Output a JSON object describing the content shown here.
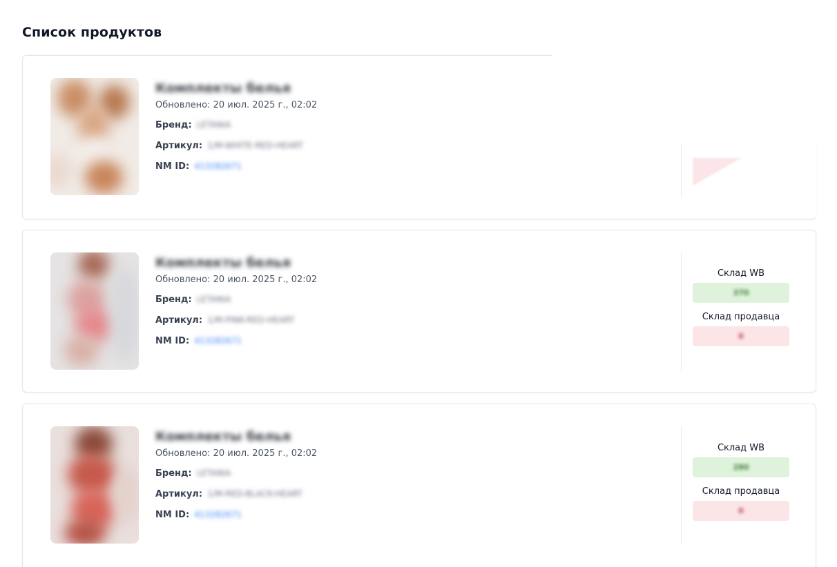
{
  "page": {
    "title": "Список продуктов"
  },
  "labels": {
    "brand": "Бренд:",
    "article": "Артикул:",
    "nm_id": "NM ID:",
    "stock_wb": "Склад WB",
    "stock_seller": "Склад продавца"
  },
  "products": [
    {
      "name": "Комплекты белья",
      "updated": "Обновлено: 20 июл. 2025 г., 02:02",
      "brand": "LETANIA",
      "article": "1/M-WHITE-RED-HEART",
      "nm_id": "413282671",
      "stock_wb": "",
      "stock_seller": ""
    },
    {
      "name": "Комплекты белья",
      "updated": "Обновлено: 20 июл. 2025 г., 02:02",
      "brand": "LETANIA",
      "article": "1/M-PINK-RED-HEART",
      "nm_id": "413282671",
      "stock_wb": "370",
      "stock_seller": "0"
    },
    {
      "name": "Комплекты белья",
      "updated": "Обновлено: 20 июл. 2025 г., 02:02",
      "brand": "LETANIA",
      "article": "1/M-RED-BLACK-HEART",
      "nm_id": "413282671",
      "stock_wb": "280",
      "stock_seller": "0"
    }
  ],
  "colors": {
    "stock_green_bg": "#dff3dc",
    "stock_red_bg": "#fbe5e7",
    "link": "#3b82f6"
  }
}
